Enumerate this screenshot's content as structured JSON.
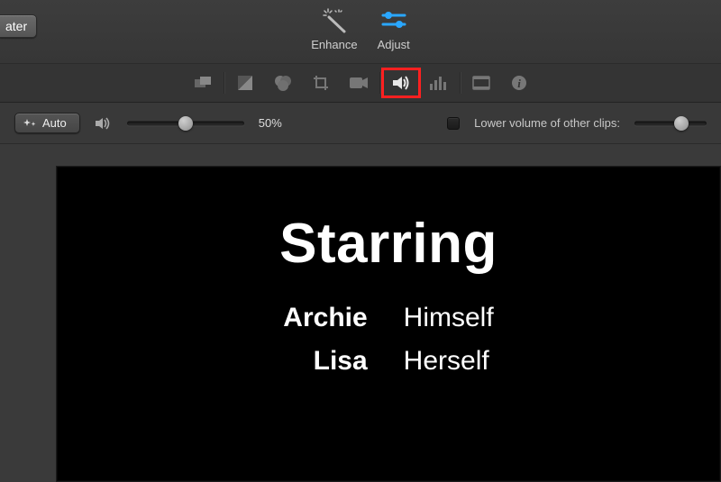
{
  "header": {
    "theater_label": "ater",
    "tools": {
      "enhance_label": "Enhance",
      "adjust_label": "Adjust"
    }
  },
  "tabs": {
    "icons": [
      "overlap-icon",
      "contrast-icon",
      "color-palette-icon",
      "crop-icon",
      "camera-icon",
      "volume-icon",
      "equalizer-icon",
      "film-icon",
      "info-icon"
    ]
  },
  "audio_controls": {
    "auto_label": "Auto",
    "volume_percent": "50%",
    "volume_slider_pos": 0.5,
    "lower_volume_label": "Lower volume of other clips:",
    "lower_volume_checked": false,
    "ducking_slider_pos": 0.65
  },
  "preview": {
    "title": "Starring",
    "credits": [
      {
        "name": "Archie",
        "role": "Himself"
      },
      {
        "name": "Lisa",
        "role": "Herself"
      }
    ]
  }
}
